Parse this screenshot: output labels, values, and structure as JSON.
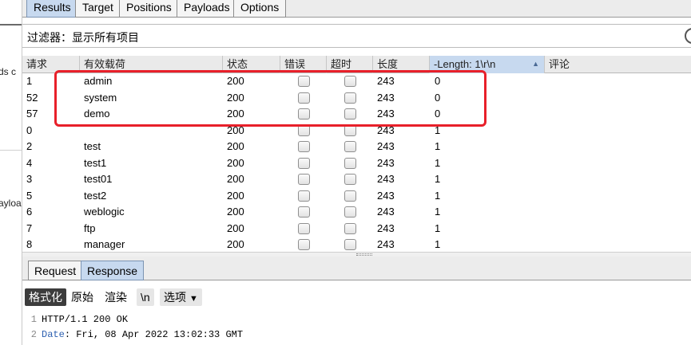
{
  "left_strip": {
    "text1": "ds c",
    "text2": "ayloa"
  },
  "top_tabs": [
    "Results",
    "Target",
    "Positions",
    "Payloads",
    "Options"
  ],
  "filter": {
    "label": "过滤器：",
    "value": "显示所有项目"
  },
  "table": {
    "columns": [
      "请求",
      "有效载荷",
      "状态",
      "错误",
      "超时",
      "长度",
      "-Length: 1\\r\\n",
      "评论"
    ],
    "sorted_column": 6,
    "rows": [
      {
        "request": "1",
        "payload": "admin",
        "status": "200",
        "error": false,
        "timeout": false,
        "length": "243",
        "grep": "0",
        "comment": ""
      },
      {
        "request": "52",
        "payload": "system",
        "status": "200",
        "error": false,
        "timeout": false,
        "length": "243",
        "grep": "0",
        "comment": ""
      },
      {
        "request": "57",
        "payload": "demo",
        "status": "200",
        "error": false,
        "timeout": false,
        "length": "243",
        "grep": "0",
        "comment": ""
      },
      {
        "request": "0",
        "payload": "",
        "status": "200",
        "error": false,
        "timeout": false,
        "length": "243",
        "grep": "1",
        "comment": ""
      },
      {
        "request": "2",
        "payload": "test",
        "status": "200",
        "error": false,
        "timeout": false,
        "length": "243",
        "grep": "1",
        "comment": ""
      },
      {
        "request": "4",
        "payload": "test1",
        "status": "200",
        "error": false,
        "timeout": false,
        "length": "243",
        "grep": "1",
        "comment": ""
      },
      {
        "request": "3",
        "payload": "test01",
        "status": "200",
        "error": false,
        "timeout": false,
        "length": "243",
        "grep": "1",
        "comment": ""
      },
      {
        "request": "5",
        "payload": "test2",
        "status": "200",
        "error": false,
        "timeout": false,
        "length": "243",
        "grep": "1",
        "comment": ""
      },
      {
        "request": "6",
        "payload": "weblogic",
        "status": "200",
        "error": false,
        "timeout": false,
        "length": "243",
        "grep": "1",
        "comment": ""
      },
      {
        "request": "7",
        "payload": "ftp",
        "status": "200",
        "error": false,
        "timeout": false,
        "length": "243",
        "grep": "1",
        "comment": ""
      },
      {
        "request": "8",
        "payload": "manager",
        "status": "200",
        "error": false,
        "timeout": false,
        "length": "243",
        "grep": "1",
        "comment": ""
      }
    ]
  },
  "bottom_tabs": [
    "Request",
    "Response"
  ],
  "active_bottom_tab": 1,
  "toolbar": {
    "pretty": "格式化",
    "raw": "原始",
    "render": "渲染",
    "newline": "\\n",
    "options": "选项"
  },
  "code_lines": [
    {
      "n": "1",
      "key": "",
      "rest": "HTTP/1.1 200 OK"
    },
    {
      "n": "2",
      "key": "Date",
      "rest": ": Fri, 08 Apr 2022 13:02:33 GMT"
    }
  ],
  "colors": {
    "active_tab": "#c7d9ef",
    "highlight": "#e8202a",
    "header_key": "#2c5fb0"
  }
}
